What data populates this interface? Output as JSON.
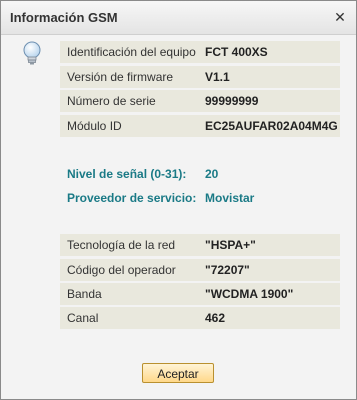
{
  "window": {
    "title": "Información GSM"
  },
  "device": [
    {
      "label": "Identificación del equipo",
      "value": "FCT 400XS"
    },
    {
      "label": "Versión de firmware",
      "value": "V1.1"
    },
    {
      "label": "Número de serie",
      "value": "99999999"
    },
    {
      "label": "Módulo ID",
      "value": "EC25AUFAR02A04M4G"
    }
  ],
  "signal": [
    {
      "label": "Nivel de señal (0-31):",
      "value": "20"
    },
    {
      "label": "Proveedor de servicio:",
      "value": "Movistar"
    }
  ],
  "network": [
    {
      "label": "Tecnología de la red",
      "value": "\"HSPA+\""
    },
    {
      "label": "Código del operador",
      "value": "\"72207\""
    },
    {
      "label": "Banda",
      "value": "\"WCDMA 1900\""
    },
    {
      "label": "Canal",
      "value": "462"
    }
  ],
  "buttons": {
    "accept": "Aceptar"
  },
  "colors": {
    "accent": "#1a7a86",
    "row_bg": "#e9e8dd",
    "button": "#ffd88a"
  },
  "icons": {
    "close": "close-icon",
    "info": "lightbulb-icon"
  }
}
